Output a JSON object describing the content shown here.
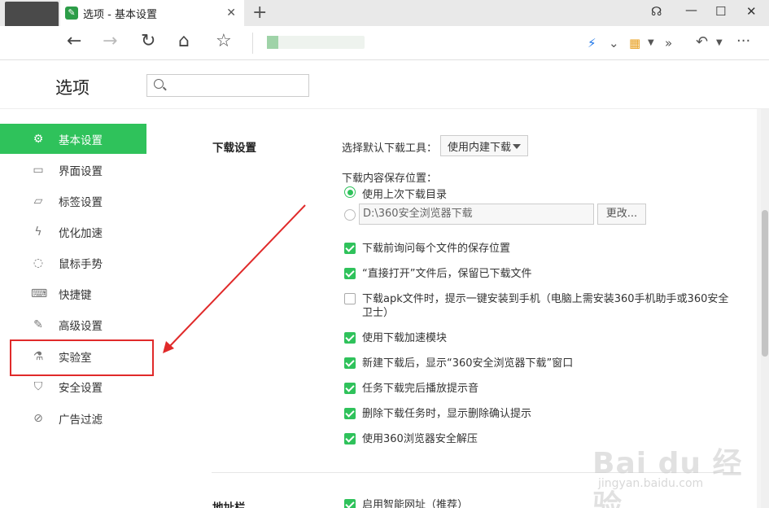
{
  "tab": {
    "title": "选项 - 基本设置",
    "close": "✕",
    "new_tab": "+"
  },
  "options": {
    "title": "选项",
    "search_placeholder": ""
  },
  "sidebar": {
    "items": [
      {
        "label": "基本设置",
        "icon": "gear-icon"
      },
      {
        "label": "界面设置",
        "icon": "window-icon"
      },
      {
        "label": "标签设置",
        "icon": "laptop-icon"
      },
      {
        "label": "优化加速",
        "icon": "lightning-icon"
      },
      {
        "label": "鼠标手势",
        "icon": "mouse-icon"
      },
      {
        "label": "快捷键",
        "icon": "keyboard-icon"
      },
      {
        "label": "高级设置",
        "icon": "wrench-icon"
      },
      {
        "label": "实验室",
        "icon": "flask-icon"
      },
      {
        "label": "安全设置",
        "icon": "shield-icon"
      },
      {
        "label": "广告过滤",
        "icon": "block-icon"
      }
    ]
  },
  "download": {
    "section_title": "下载设置",
    "tool_label": "选择默认下载工具：",
    "tool_value": "使用内建下载",
    "location_label": "下载内容保存位置：",
    "radio_last": "使用上次下载目录",
    "path_value": "D:\\360安全浏览器下载",
    "change_button": "更改...",
    "checks": [
      {
        "label": "下载前询问每个文件的保存位置",
        "checked": true
      },
      {
        "label": "“直接打开”文件后，保留已下载文件",
        "checked": true
      },
      {
        "label": "下载apk文件时，提示一键安装到手机（电脑上需安装360手机助手或360安全卫士）",
        "checked": false
      },
      {
        "label": "使用下载加速模块",
        "checked": true
      },
      {
        "label": "新建下载后，显示“360安全浏览器下载”窗口",
        "checked": true
      },
      {
        "label": "任务下载完后播放提示音",
        "checked": true
      },
      {
        "label": "删除下载任务时，显示删除确认提示",
        "checked": true
      },
      {
        "label": "使用360浏览器安全解压",
        "checked": true
      }
    ]
  },
  "addressbar": {
    "section_title": "地址栏",
    "first_check": "启用智能网址（推荐）"
  },
  "watermark": {
    "main": "Bai du 经验",
    "sub": "jingyan.baidu.com"
  },
  "colors": {
    "accent": "#2fc25b",
    "highlight": "#e02a2a"
  }
}
